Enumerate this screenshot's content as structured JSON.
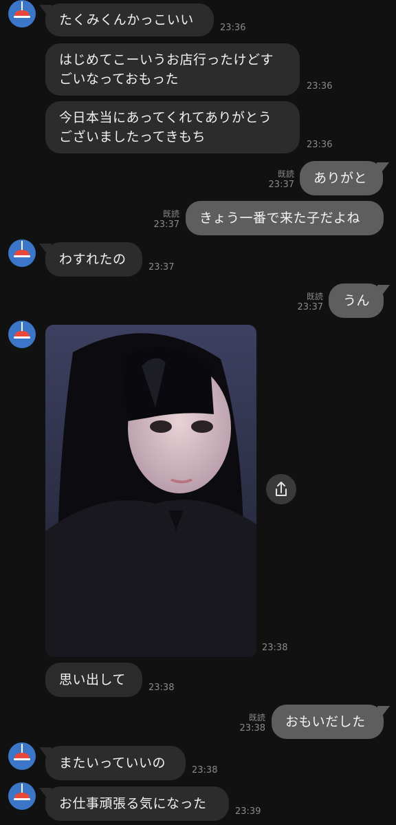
{
  "chat": {
    "read_label": "既読",
    "messages": [
      {
        "side": "received",
        "text": "たくみくんかっこいい",
        "time": "23:36"
      },
      {
        "side": "received",
        "text_lines": [
          "はじめてこーいうお店行ったけどす",
          "ごいなっておもった"
        ],
        "time": "23:36"
      },
      {
        "side": "received",
        "text_lines": [
          "今日本当にあってくれてありがとう",
          "ございましたってきもち"
        ],
        "time": "23:36"
      },
      {
        "side": "sent",
        "text": "ありがと",
        "read": "既読",
        "time": "23:37"
      },
      {
        "side": "sent",
        "text": "きょう一番で来た子だよね",
        "read": "既読",
        "time": "23:37"
      },
      {
        "side": "received",
        "text": "わすれたの",
        "time": "23:37"
      },
      {
        "side": "sent",
        "text": "うん",
        "read": "既読",
        "time": "23:37"
      },
      {
        "side": "received",
        "type": "image",
        "image_desc": "selfie photo",
        "time": "23:38"
      },
      {
        "side": "received",
        "text": "思い出して",
        "time": "23:38"
      },
      {
        "side": "sent",
        "text": "おもいだした",
        "read": "既読",
        "time": "23:38"
      },
      {
        "side": "received",
        "text": "またいっていいの",
        "time": "23:38"
      },
      {
        "side": "received",
        "text": "お仕事頑張る気になった",
        "time": "23:39"
      }
    ]
  },
  "icons": {
    "avatar": "lamp-avatar-icon",
    "share": "share-icon"
  },
  "colors": {
    "background": "#111111",
    "received_bubble": "#2c2c2c",
    "sent_bubble": "#5e5e5e",
    "avatar_bg": "#3b76c8",
    "avatar_lamp": "#e8493c"
  }
}
